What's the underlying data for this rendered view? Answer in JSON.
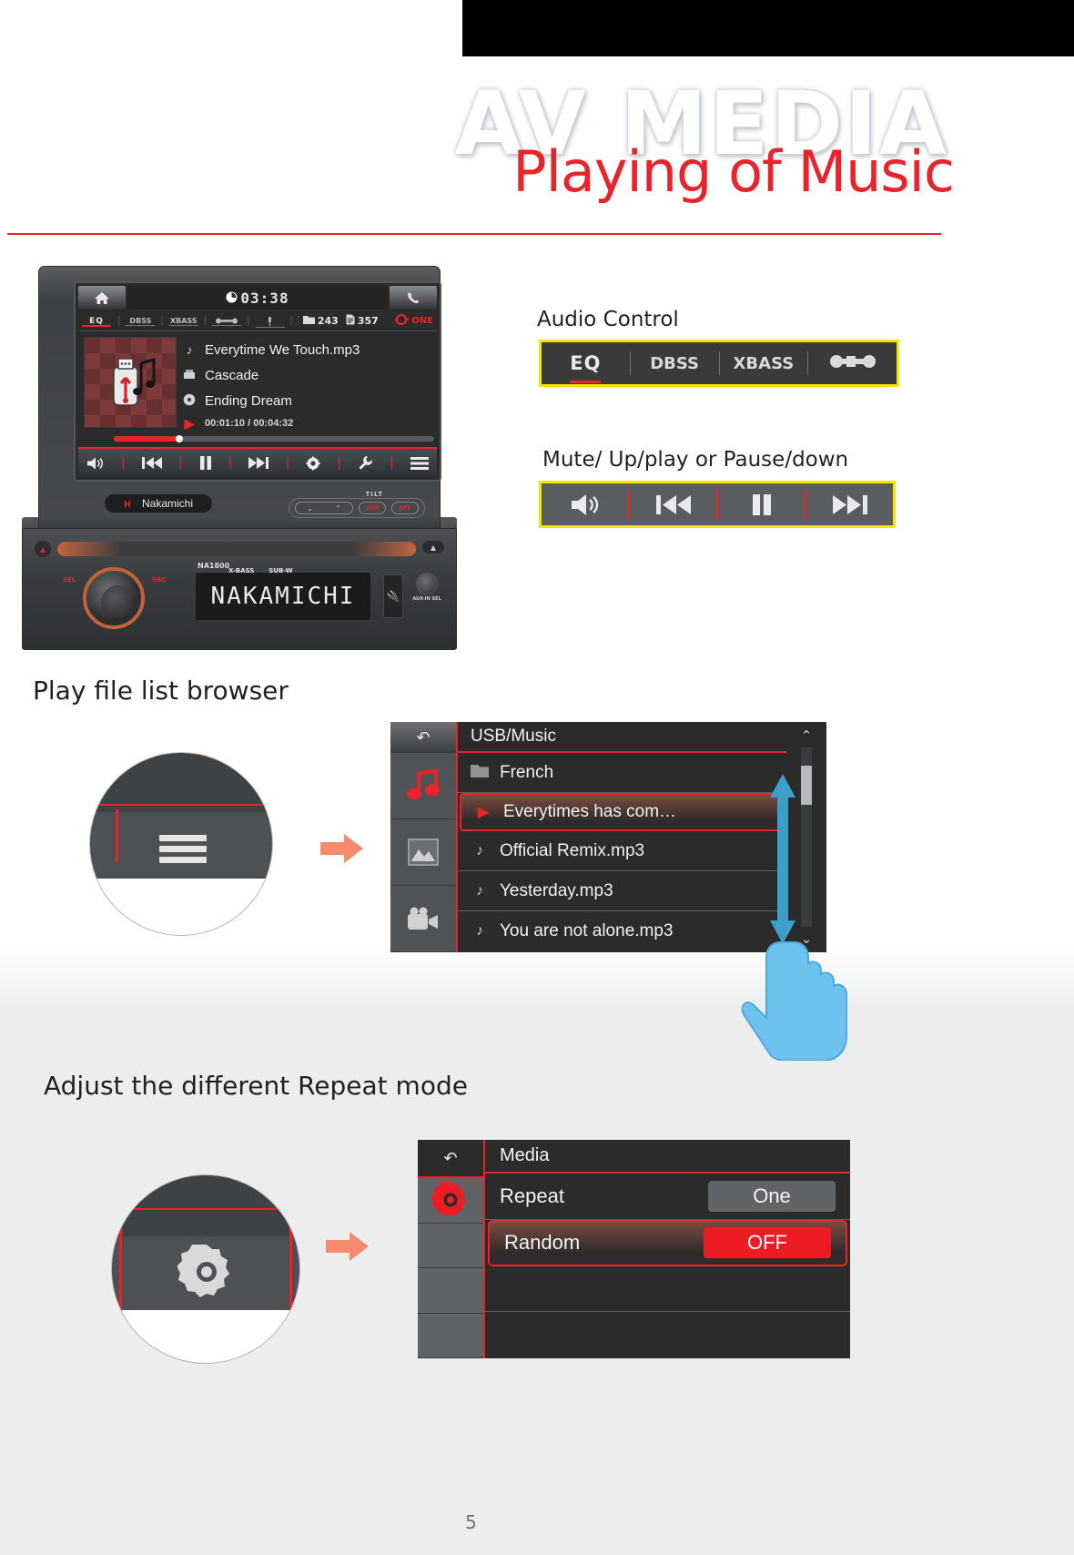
{
  "header": {
    "watermark": "AV MEDIA",
    "title": "Playing of Music"
  },
  "stereo_screen": {
    "home_icon": "home-icon",
    "clock_icon": "clock-icon",
    "clock": "03:38",
    "phone_icon": "phone-icon",
    "status": {
      "eq": "EQ",
      "dbss": "DBSS",
      "xbass": "XBASS",
      "loudness": "LOUD",
      "mic": "MIC",
      "folder_count": "243",
      "file_count": "357",
      "repeat_mode": "ONE"
    },
    "track": {
      "title": "Everytime We Touch.mp3",
      "artist": "Cascade",
      "album": "Ending Dream",
      "time": "00:01:10 / 00:04:32"
    },
    "controls": [
      "mute-icon",
      "previous-icon",
      "pause-icon",
      "next-icon",
      "settings-icon",
      "tools-icon",
      "list-icon"
    ]
  },
  "faceplate": {
    "brand": "Nakamichi",
    "tilt_label": "TILT",
    "tilt_down": "⌄",
    "tilt_up": "⌃",
    "btn_dim": "DIM",
    "btn_aff": "AFF",
    "model": "NA1800",
    "tag_xbass": "X-BASS",
    "tag_subw": "SUB-W",
    "lcd_text": "NAKAMICHI",
    "knob_left": "SEL",
    "knob_right": "SRC",
    "aux_label": "AUX-IN\nSEL"
  },
  "audio_control": {
    "title": "Audio Control",
    "items": [
      {
        "label": "EQ",
        "active": true
      },
      {
        "label": "DBSS",
        "active": false
      },
      {
        "label": "XBASS",
        "active": false
      },
      {
        "label": "LOUDNESS",
        "active": false
      }
    ]
  },
  "transport_control": {
    "title": "Mute/ Up/play or Pause/down",
    "items": [
      "mute-icon",
      "previous-icon",
      "pause-icon",
      "next-icon"
    ]
  },
  "sections": {
    "browser_title": "Play file list browser",
    "repeat_title": "Adjust the different Repeat mode"
  },
  "file_browser": {
    "back_icon": "back-arrow-icon",
    "path": "USB/Music",
    "side_items": [
      "music-note-icon",
      "picture-icon",
      "video-icon"
    ],
    "rows": [
      {
        "icon": "folder-icon",
        "label": "French",
        "selected": false
      },
      {
        "icon": "play-icon",
        "label": "Everytimes has com…",
        "selected": true
      },
      {
        "icon": "music-note-icon",
        "label": "Official Remix.mp3",
        "selected": false
      },
      {
        "icon": "music-note-icon",
        "label": "Yesterday.mp3",
        "selected": false
      },
      {
        "icon": "music-note-icon",
        "label": "You are not alone.mp3",
        "selected": false
      }
    ],
    "scroll_up": "⌃",
    "scroll_down": "⌄"
  },
  "settings_panel": {
    "back_icon": "back-arrow-icon",
    "title": "Media",
    "side_items": [
      "gear-icon",
      "blank",
      "blank",
      "blank"
    ],
    "rows": [
      {
        "label": "Repeat",
        "value": "One",
        "selected": false,
        "value_style": "grey"
      },
      {
        "label": "Random",
        "value": "OFF",
        "selected": true,
        "value_style": "red"
      }
    ]
  },
  "footer": {
    "page_number": "5"
  },
  "colors": {
    "accent_red": "#e8232a",
    "highlight_yellow": "#f5e400",
    "value_red": "#ed1c24",
    "hand_blue": "#5cb8e6"
  }
}
